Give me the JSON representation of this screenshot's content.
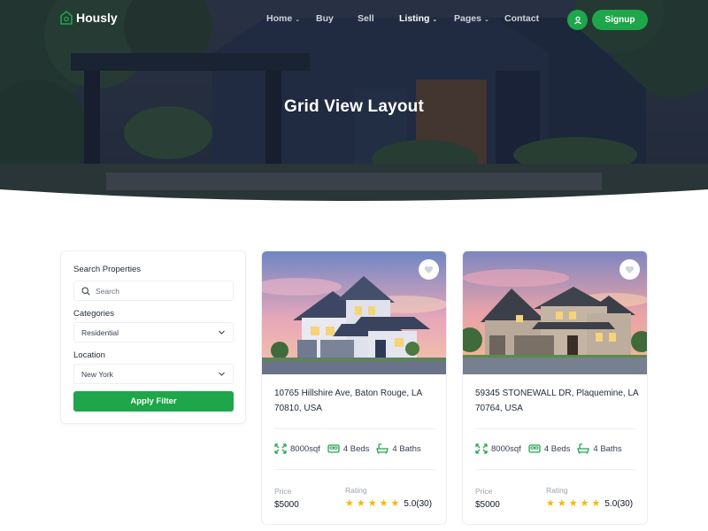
{
  "brand": {
    "name": "Hously",
    "accent": "#1ea64a"
  },
  "nav": {
    "items": [
      {
        "label": "Home",
        "has_dropdown": true,
        "active": false
      },
      {
        "label": "Buy",
        "has_dropdown": false,
        "active": false
      },
      {
        "label": "Sell",
        "has_dropdown": false,
        "active": false
      },
      {
        "label": "Listing",
        "has_dropdown": true,
        "active": true
      },
      {
        "label": "Pages",
        "has_dropdown": true,
        "active": false
      },
      {
        "label": "Contact",
        "has_dropdown": false,
        "active": false
      }
    ],
    "user_icon": "user-icon",
    "signup_label": "Signup"
  },
  "hero": {
    "title": "Grid View Layout"
  },
  "filter": {
    "search_label": "Search Properties",
    "search_placeholder": "Search",
    "categories_label": "Categories",
    "categories_value": "Residential",
    "location_label": "Location",
    "location_value": "New York",
    "apply_label": "Apply Filter"
  },
  "properties": [
    {
      "address_line1": "10765 Hillshire Ave, Baton Rouge, LA",
      "address_line2": "70810, USA",
      "area": "8000sqf",
      "beds": "4 Beds",
      "baths": "4 Baths",
      "price_label": "Price",
      "price": "$5000",
      "rating_label": "Rating",
      "rating": 5,
      "rating_text": "5.0(30)"
    },
    {
      "address_line1": "59345 STONEWALL DR, Plaquemine, LA",
      "address_line2": "70764, USA",
      "area": "8000sqf",
      "beds": "4 Beds",
      "baths": "4 Baths",
      "price_label": "Price",
      "price": "$5000",
      "rating_label": "Rating",
      "rating": 5,
      "rating_text": "5.0(30)"
    }
  ]
}
